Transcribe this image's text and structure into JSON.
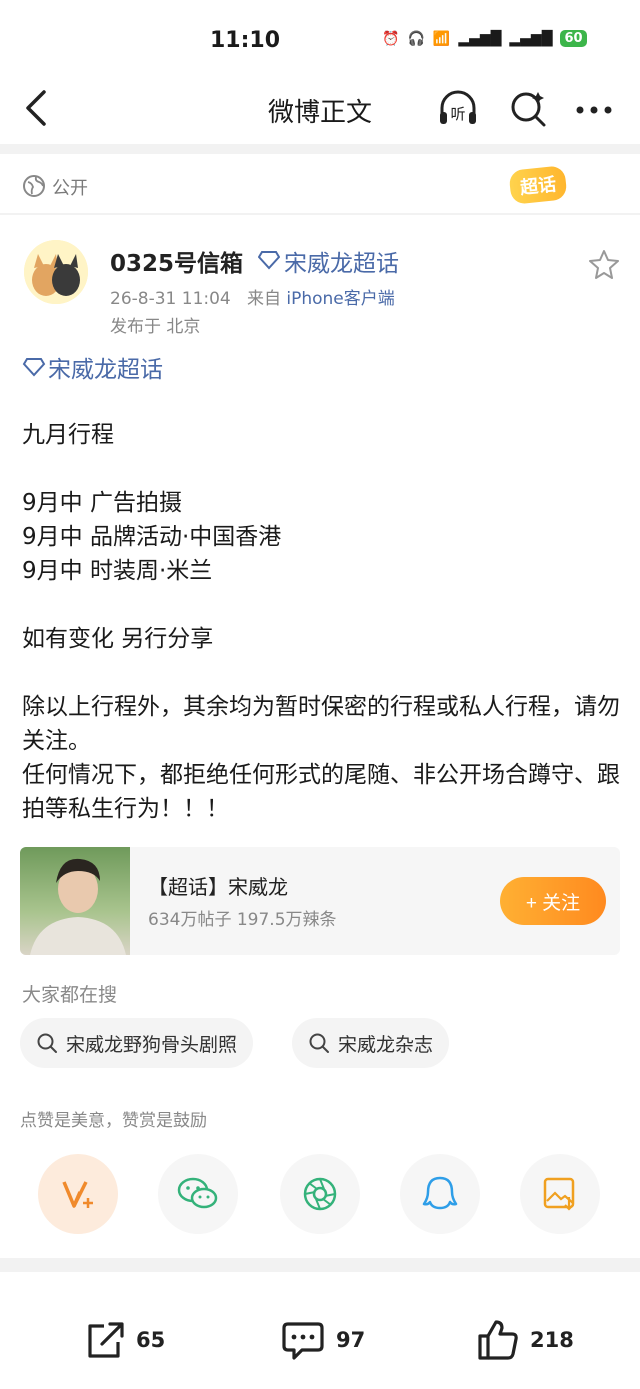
{
  "status": {
    "time": "11:10",
    "battery": "60"
  },
  "nav": {
    "title": "微博正文",
    "listen_label": "听"
  },
  "visibility": {
    "label": "公开",
    "badge": "超话"
  },
  "post": {
    "username": "0325号信箱",
    "topic_link": "宋威龙超话",
    "date": "26-8-31 11:04",
    "from_prefix": "来自",
    "client": "iPhone客户端",
    "location": "发布于 北京",
    "topic_tag": "宋威龙超话",
    "body": "九月行程\n\n9月中 广告拍摄\n9月中 品牌活动·中国香港\n9月中 时装周·米兰\n\n如有变化 另行分享\n\n除以上行程外，其余均为暂时保密的行程或私人行程，请勿关注。\n任何情况下，都拒绝任何形式的尾随、非公开场合蹲守、跟拍等私生行为！！！"
  },
  "card": {
    "title": "【超话】宋威龙",
    "subtitle": "634万帖子 197.5万辣条",
    "follow_label": "+ 关注"
  },
  "search": {
    "label": "大家都在搜",
    "chips": [
      "宋威龙野狗骨头剧照",
      "宋威龙杂志"
    ]
  },
  "share": {
    "hint": "点赞是美意，赞赏是鼓励",
    "icons": [
      "reward-icon",
      "wechat-icon",
      "moments-icon",
      "qq-icon",
      "save-image-icon"
    ]
  },
  "actions": {
    "repost": "65",
    "comment": "97",
    "like": "218"
  },
  "colors": {
    "link": "#4a6aa8",
    "accent": "#ff8a1f"
  }
}
